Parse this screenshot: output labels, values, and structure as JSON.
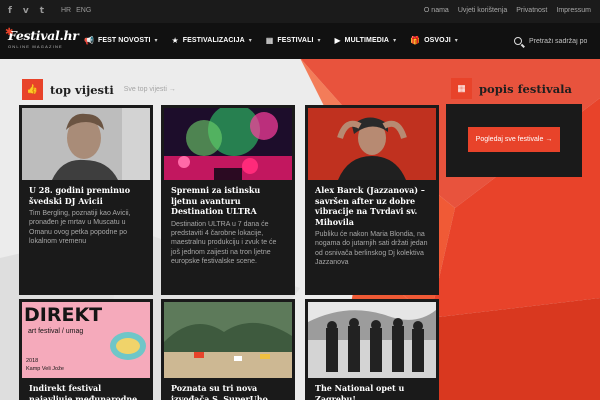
{
  "colors": {
    "accent": "#e8432a",
    "dark": "#1a1a1a",
    "topbar": "#1b1b1b",
    "navbar": "#111111"
  },
  "topbar": {
    "social": [
      {
        "glyph": "f",
        "icon": "facebook-icon"
      },
      {
        "glyph": "v",
        "icon": "vimeo-icon"
      },
      {
        "glyph": "t",
        "icon": "tumblr-icon"
      }
    ],
    "langs": [
      "HR",
      "ENG"
    ],
    "links": [
      "O nama",
      "Uvjeti korištenja",
      "Privatnost",
      "Impressum"
    ]
  },
  "logo": {
    "main": "Festival.hr",
    "sub": "ONLINE MAGAZINE"
  },
  "nav": [
    {
      "label": "FEST NOVOSTI",
      "glyph": "📢",
      "icon": "megaphone-icon"
    },
    {
      "label": "FESTIVALIZACIJA",
      "glyph": "★",
      "icon": "star-icon"
    },
    {
      "label": "FESTIVALI",
      "glyph": "▦",
      "icon": "calendar-icon"
    },
    {
      "label": "MULTIMEDIA",
      "glyph": "▶",
      "icon": "play-icon"
    },
    {
      "label": "OSVOJI",
      "glyph": "🎁",
      "icon": "gift-icon"
    }
  ],
  "search": {
    "placeholder": "Pretraži sadržaj po"
  },
  "main": {
    "title": "top vijesti",
    "link": "Sve top vijesti →",
    "icon": "thumbs-up-icon",
    "glyph": "👍"
  },
  "sidebar": {
    "title": "popis festivala",
    "icon": "calendar-icon",
    "glyph": "▦",
    "button": "Pogledaj sve festivale →"
  },
  "articles": [
    {
      "title": "U 28. godini preminuo švedski DJ Avicii",
      "excerpt": "Tim Bergling, poznatiji kao Avicii, pronađen je mrtav u Muscatu u Omanu ovog petka popodne po lokalnom vremenu"
    },
    {
      "title": "Spremni za istinsku ljetnu avanturu Destination ULTRA",
      "excerpt": "Destination ULTRA u 7 dana će predstaviti 4 čarobne lokacije, maestralnu produkciju i zvuk te će još jednom zaijesti na tron ljetne europske festivalske scene."
    },
    {
      "title": "Alex Barck (Jazzanova) – savršen after uz dobre vibracije na Tvrdavi sv. Mihovila",
      "excerpt": "Publiku će nakon Maria Blondia, na nogama do jutarnjih sati držati jedan od osnivača berlinskog Dj kolektiva Jazzanova"
    },
    {
      "title": "Indirekt festival najavljuje međunarodne suradnje i",
      "excerpt": "",
      "img_text": {
        "big": "DIREKT",
        "line": "art festival / umag",
        "year": "2018",
        "place": "Kamp Veli Jože"
      }
    },
    {
      "title": "Poznata su tri nova izvođača S. SuperUho",
      "excerpt": ""
    },
    {
      "title": "The National opet u Zagrebu!",
      "excerpt": ""
    }
  ]
}
